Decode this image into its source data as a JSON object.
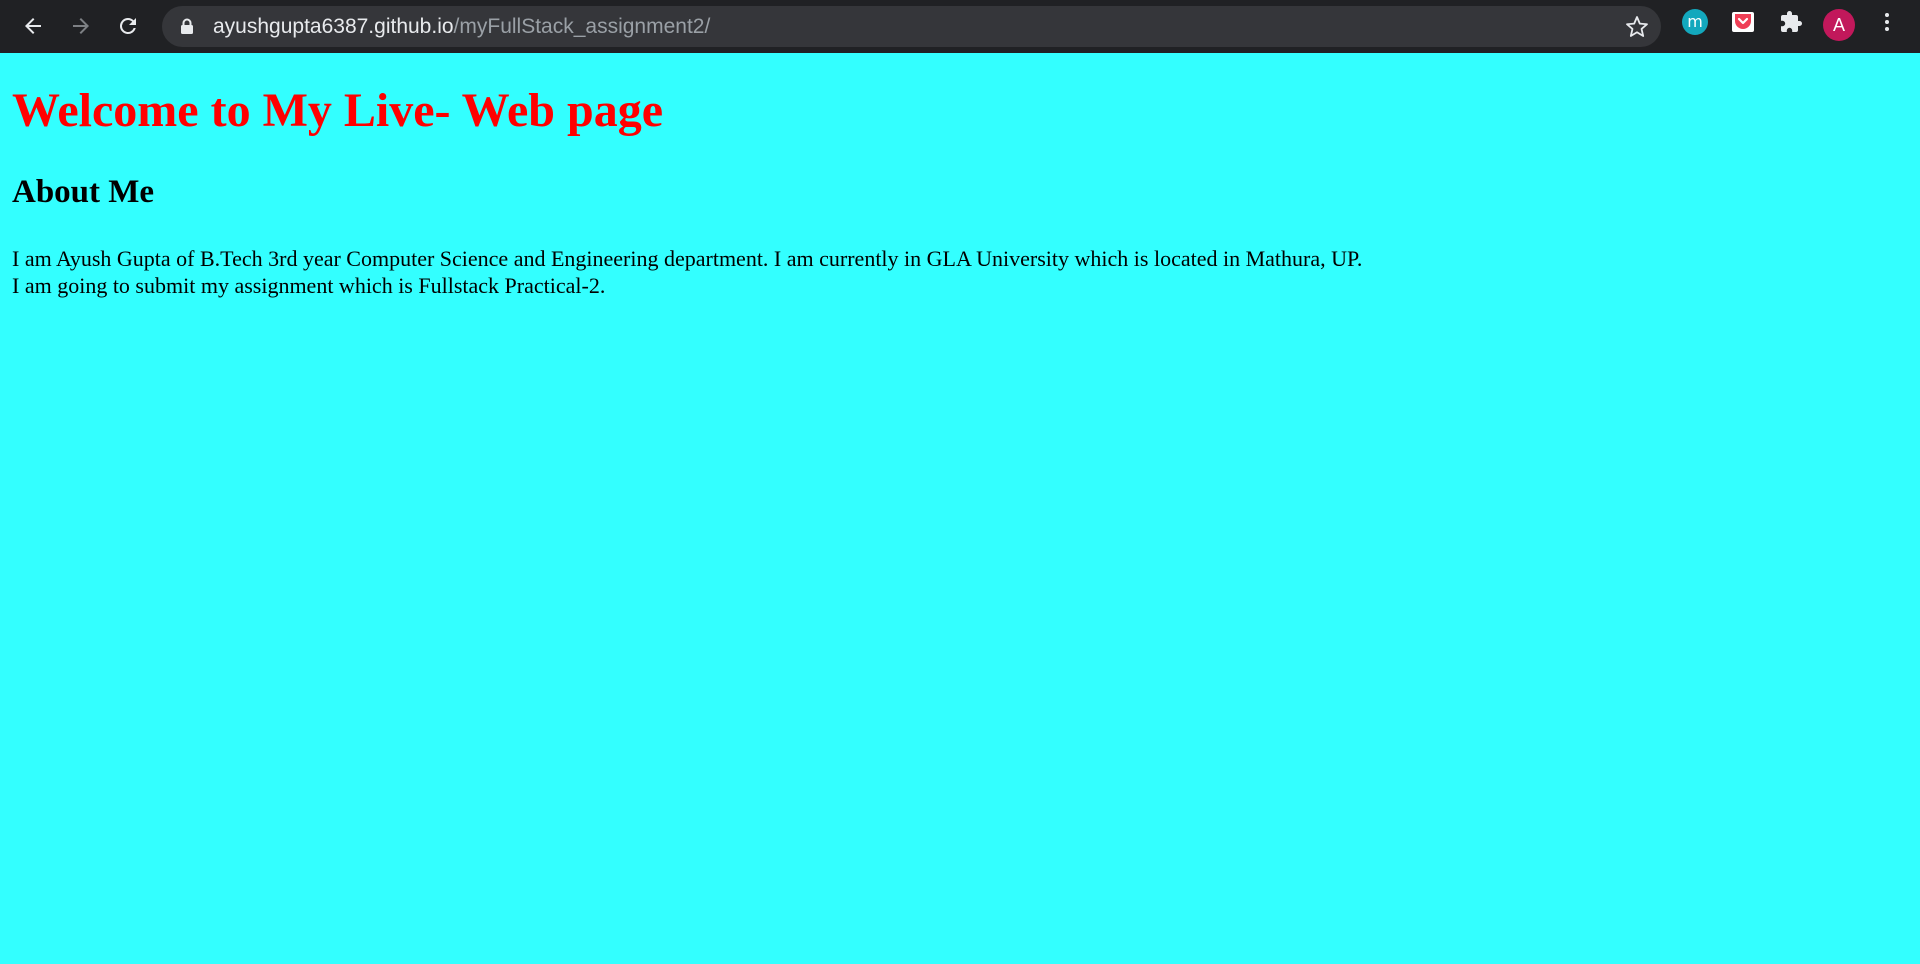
{
  "browser": {
    "url_host": "ayushgupta6387.github.io",
    "url_path": "/myFullStack_assignment2/",
    "extensions": {
      "m_label": "m",
      "avatar_label": "A"
    },
    "icons": [
      "back-arrow-icon",
      "forward-arrow-icon",
      "reload-icon",
      "lock-icon",
      "star-icon",
      "pocket-icon",
      "puzzle-icon",
      "kebab-menu-icon"
    ],
    "colors": {
      "toolbar": "#202124",
      "omnibox": "#35363a",
      "avatar": "#c2185b",
      "ext_m": "#13a8bd"
    }
  },
  "page": {
    "background": "#33ffff",
    "title": "Welcome to My Live- Web page",
    "title_color": "#ff0000",
    "heading": "About Me",
    "paragraph_line1": "I am Ayush Gupta of B.Tech 3rd year Computer Science and Engineering department. I am currently in GLA University which is located in Mathura, UP.",
    "paragraph_line2": "I am going to submit my assignment which is Fullstack Practical-2."
  }
}
